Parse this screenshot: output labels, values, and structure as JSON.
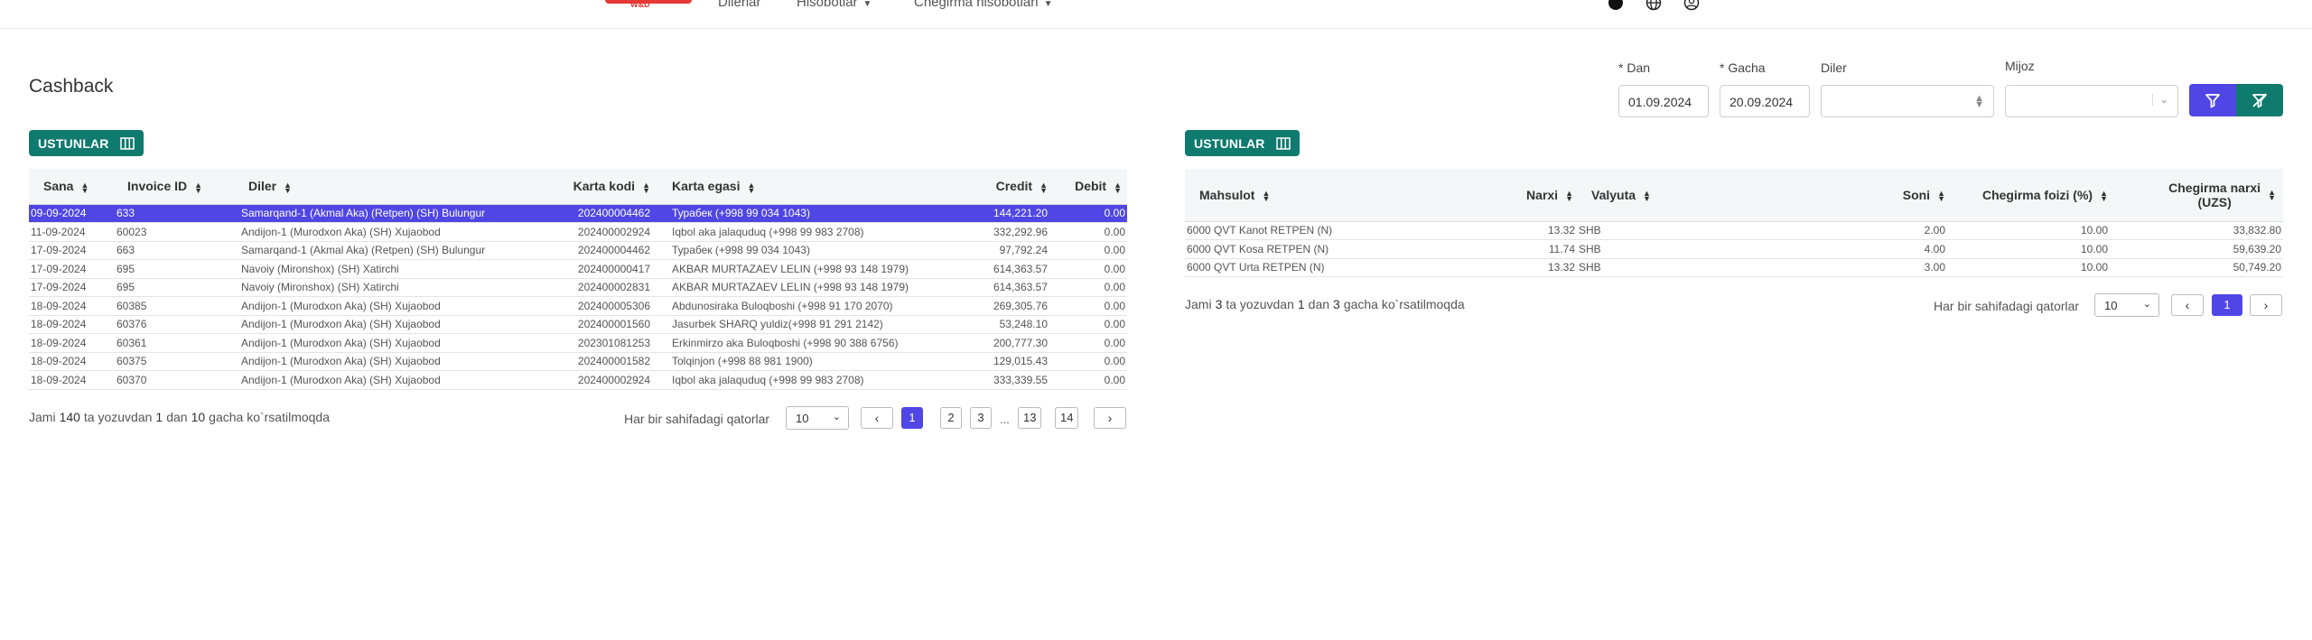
{
  "header": {
    "logo_sub": "W&D",
    "nav": [
      {
        "label": "Dilerlar"
      },
      {
        "label": "Hisobotlar"
      },
      {
        "label": "Chegirma hisobotlari"
      }
    ]
  },
  "page": {
    "title": "Cashback"
  },
  "filters": {
    "dan_label": "* Dan",
    "dan_value": "01.09.2024",
    "gacha_label": "* Gacha",
    "gacha_value": "20.09.2024",
    "diler_label": "Diler",
    "diler_value": "",
    "mijoz_label": "Mijoz",
    "mijoz_value": ""
  },
  "left": {
    "columns_button": "USTUNLAR",
    "headers": [
      "Sana",
      "Invoice ID",
      "Diler",
      "Karta kodi",
      "Karta egasi",
      "Credit",
      "Debit"
    ],
    "rows": [
      [
        "09-09-2024",
        "633",
        "Samarqand-1 (Akmal Aka) (Retpen) (SH) Bulungur",
        "202400004462",
        "Турабек (+998 99 034 1043)",
        "144,221.20",
        "0.00"
      ],
      [
        "11-09-2024",
        "60023",
        "Andijon-1 (Murodxon Aka) (SH) Xujaobod",
        "202400002924",
        "Iqbol aka jalaquduq (+998 99 983 2708)",
        "332,292.96",
        "0.00"
      ],
      [
        "17-09-2024",
        "663",
        "Samarqand-1 (Akmal Aka) (Retpen) (SH) Bulungur",
        "202400004462",
        "Турабек (+998 99 034 1043)",
        "97,792.24",
        "0.00"
      ],
      [
        "17-09-2024",
        "695",
        "Navoiy (Mironshox) (SH) Xatirchi",
        "202400000417",
        "AKBAR MURTAZAEV LELIN (+998 93 148 1979)",
        "614,363.57",
        "0.00"
      ],
      [
        "17-09-2024",
        "695",
        "Navoiy (Mironshox) (SH) Xatirchi",
        "202400002831",
        "AKBAR MURTAZAEV LELIN (+998 93 148 1979)",
        "614,363.57",
        "0.00"
      ],
      [
        "18-09-2024",
        "60385",
        "Andijon-1 (Murodxon Aka) (SH) Xujaobod",
        "202400005306",
        "Abdunosiraka Buloqboshi (+998 91 170 2070)",
        "269,305.76",
        "0.00"
      ],
      [
        "18-09-2024",
        "60376",
        "Andijon-1 (Murodxon Aka) (SH) Xujaobod",
        "202400001560",
        "Jasurbek SHARQ yuldiz(+998 91 291 2142)",
        "53,248.10",
        "0.00"
      ],
      [
        "18-09-2024",
        "60361",
        "Andijon-1 (Murodxon Aka) (SH) Xujaobod",
        "202301081253",
        "Erkinmirzo aka Buloqboshi (+998 90 388 6756)",
        "200,777.30",
        "0.00"
      ],
      [
        "18-09-2024",
        "60375",
        "Andijon-1 (Murodxon Aka) (SH) Xujaobod",
        "202400001582",
        "Tolqinjon (+998 88 981 1900)",
        "129,015.43",
        "0.00"
      ],
      [
        "18-09-2024",
        "60370",
        "Andijon-1 (Murodxon Aka) (SH) Xujaobod",
        "202400002924",
        "Iqbol aka jalaquduq (+998 99 983 2708)",
        "333,339.55",
        "0.00"
      ]
    ],
    "footer": {
      "prefix": "Jami",
      "total": "140",
      "mid1": "ta yozuvdan",
      "from": "1",
      "mid2": "dan",
      "to": "10",
      "suffix": "gacha ko`rsatilmoqda"
    },
    "rows_per_page_label": "Har bir sahifadagi qatorlar",
    "page_size": "10",
    "pages": [
      "1",
      "2",
      "3",
      "...",
      "13",
      "14"
    ]
  },
  "right": {
    "columns_button": "USTUNLAR",
    "headers": [
      "Mahsulot",
      "Narxi",
      "Valyuta",
      "Soni",
      "Chegirma foizi (%)",
      "Chegirma narxi",
      "(UZS)"
    ],
    "rows": [
      [
        "6000 QVT Kanot RETPEN (N)",
        "13.32",
        "SHB",
        "2.00",
        "10.00",
        "33,832.80"
      ],
      [
        "6000 QVT Kosa RETPEN (N)",
        "11.74",
        "SHB",
        "4.00",
        "10.00",
        "59,639.20"
      ],
      [
        "6000 QVT Urta RETPEN (N)",
        "13.32",
        "SHB",
        "3.00",
        "10.00",
        "50,749.20"
      ]
    ],
    "footer": {
      "prefix": "Jami",
      "total": "3",
      "mid1": "ta yozuvdan",
      "from": "1",
      "mid2": "dan",
      "to": "3",
      "suffix": "gacha ko`rsatilmoqda"
    },
    "rows_per_page_label": "Har bir sahifadagi qatorlar",
    "page_size": "10",
    "pages": [
      "1"
    ]
  },
  "colors": {
    "accent": "#5046e5",
    "teal": "#0f7a6e",
    "brand_red": "#e53935"
  }
}
